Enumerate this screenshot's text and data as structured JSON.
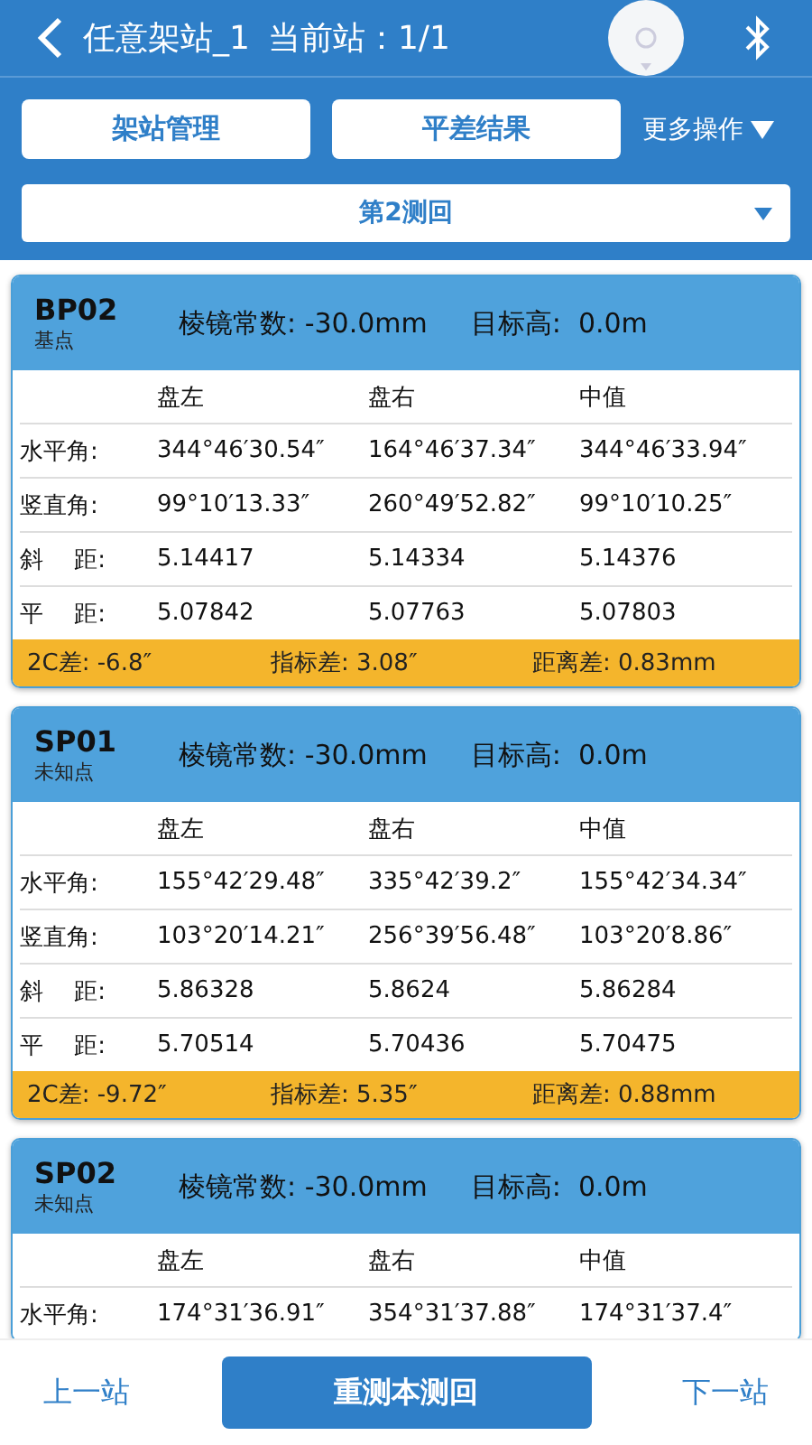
{
  "header": {
    "title": "任意架站_1",
    "station": "当前站：1/1"
  },
  "toolbar": {
    "buttons": [
      "架站管理",
      "平差结果"
    ],
    "more": "更多操作"
  },
  "round_select": {
    "value": "第2测回"
  },
  "stations": [
    {
      "name": "BP02",
      "type": "基点",
      "prism": "棱镜常数: -30.0mm",
      "target": "目标高:  0.0m",
      "columns": [
        "盘左",
        "盘右",
        "中值"
      ],
      "rows": [
        {
          "label": "水平角:",
          "values": [
            "344°46′30.54″",
            "164°46′37.34″",
            "344°46′33.94″"
          ]
        },
        {
          "label": "竖直角:",
          "values": [
            "99°10′13.33″",
            "260°49′52.82″",
            "99°10′10.25″"
          ]
        },
        {
          "label": "斜　 距:",
          "values": [
            "5.14417",
            "5.14334",
            "5.14376"
          ]
        },
        {
          "label": "平　 距:",
          "values": [
            "5.07842",
            "5.07763",
            "5.07803"
          ]
        }
      ],
      "footer": [
        "2C差: -6.8″",
        "指标差: 3.08″",
        "距离差: 0.83mm"
      ]
    },
    {
      "name": "SP01",
      "type": "未知点",
      "prism": "棱镜常数: -30.0mm",
      "target": "目标高:  0.0m",
      "columns": [
        "盘左",
        "盘右",
        "中值"
      ],
      "rows": [
        {
          "label": "水平角:",
          "values": [
            "155°42′29.48″",
            "335°42′39.2″",
            "155°42′34.34″"
          ]
        },
        {
          "label": "竖直角:",
          "values": [
            "103°20′14.21″",
            "256°39′56.48″",
            "103°20′8.86″"
          ]
        },
        {
          "label": "斜　 距:",
          "values": [
            "5.86328",
            "5.8624",
            "5.86284"
          ]
        },
        {
          "label": "平　 距:",
          "values": [
            "5.70514",
            "5.70436",
            "5.70475"
          ]
        }
      ],
      "footer": [
        "2C差: -9.72″",
        "指标差: 5.35″",
        "距离差: 0.88mm"
      ]
    },
    {
      "name": "SP02",
      "type": "未知点",
      "prism": "棱镜常数: -30.0mm",
      "target": "目标高:  0.0m",
      "columns": [
        "盘左",
        "盘右",
        "中值"
      ],
      "rows": [
        {
          "label": "水平角:",
          "values": [
            "174°31′36.91″",
            "354°31′37.88″",
            "174°31′37.4″"
          ]
        }
      ]
    }
  ],
  "bottom": {
    "prev": "上一站",
    "remeasure": "重测本测回",
    "next": "下一站"
  }
}
